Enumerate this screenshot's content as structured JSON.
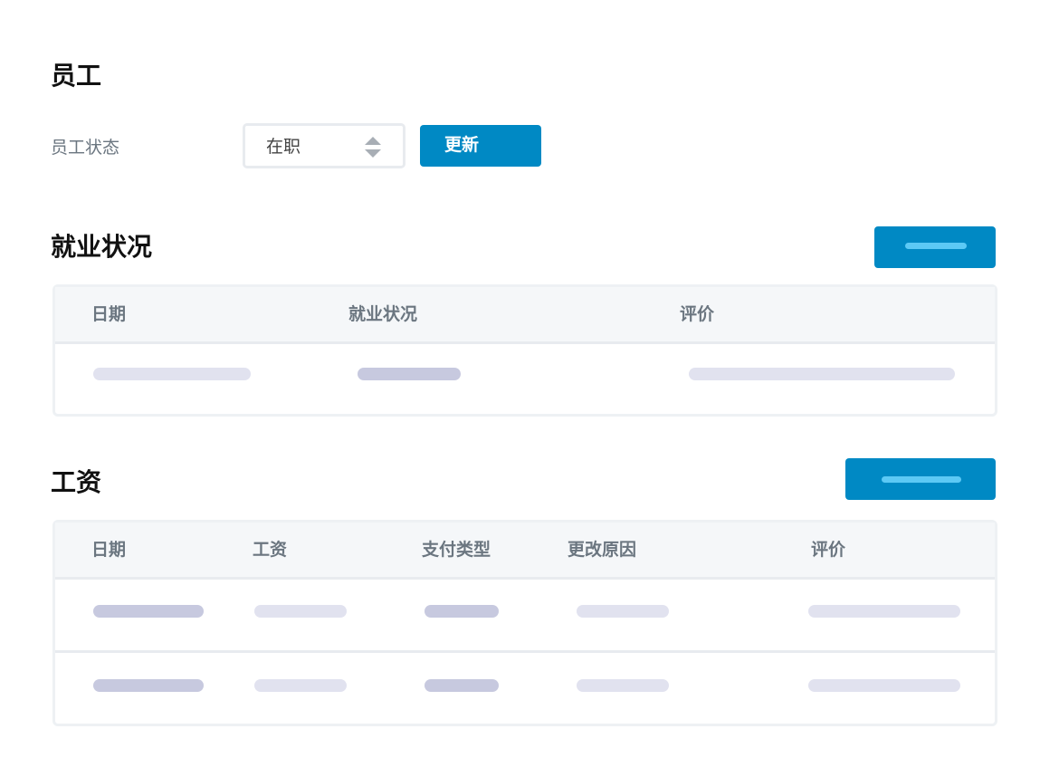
{
  "page": {
    "title": "员工"
  },
  "status_filter": {
    "label": "员工状态",
    "selected": "在职",
    "update_label": "更新"
  },
  "employment": {
    "title": "就业状况",
    "columns": [
      "日期",
      "就业状况",
      "评价"
    ]
  },
  "salary": {
    "title": "工资",
    "columns": [
      "日期",
      "工资",
      "支付类型",
      "更改原因",
      "评价"
    ]
  },
  "colors": {
    "accent": "#0089c4",
    "accent_light": "#5cc9f5",
    "skeleton_dark": "#c7c9df",
    "skeleton_light": "#e1e2ef",
    "header_bg": "#f5f7f9",
    "border": "#eef1f4"
  },
  "icons": {
    "select": "sort-arrows-icon"
  }
}
